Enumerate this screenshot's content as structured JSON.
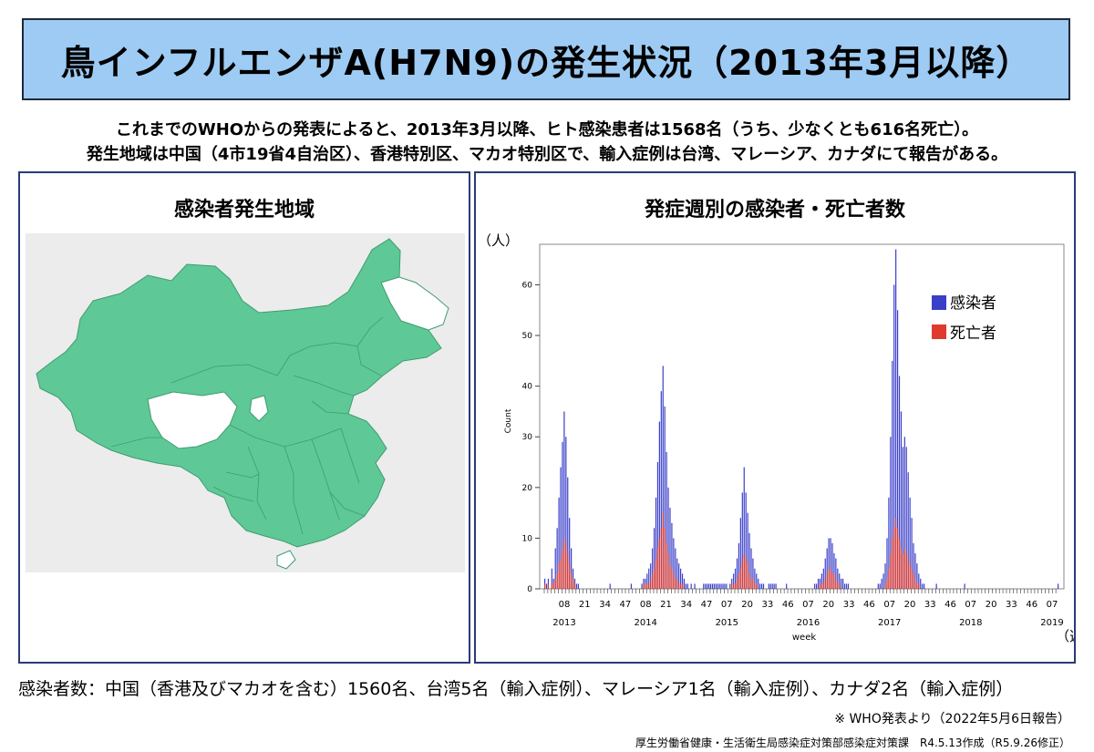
{
  "title": "鳥インフルエンザA(H7N9)の発生状況（2013年3月以降）",
  "summary": {
    "line1": "これまでのWHOからの発表によると、2013年3月以降、ヒト感染患者は1568名（うち、少なくとも616名死亡）。",
    "line2": "発生地域は中国（4市19省4自治区）、香港特別区、マカオ特別区で、輸入症例は台湾、マレーシア、カナダにて報告がある。"
  },
  "map_panel": {
    "title": "感染者発生地域",
    "colors": {
      "affected": "#5ec996",
      "unaffected": "#ffffff",
      "background": "#ececec"
    }
  },
  "chart_panel": {
    "title": "発症週別の感染者・死亡者数",
    "unit_y": "（人）",
    "unit_x": "（週）"
  },
  "chart_data": {
    "type": "bar",
    "ylabel": "Count",
    "xlabel": "week",
    "ylim": [
      0,
      68
    ],
    "yticks": [
      0,
      10,
      20,
      30,
      40,
      50,
      60
    ],
    "week_ticks": [
      "08",
      "21",
      "34",
      "47",
      "08",
      "21",
      "34",
      "47",
      "07",
      "20",
      "33",
      "46",
      "07",
      "20",
      "33",
      "46",
      "07",
      "20",
      "33",
      "46",
      "07",
      "20",
      "33",
      "46",
      "07"
    ],
    "year_labels": [
      "2013",
      "2014",
      "2015",
      "2016",
      "2017",
      "2018",
      "2019"
    ],
    "legend": [
      "感染者",
      "死亡者"
    ],
    "colors": {
      "cases": "#3a3fc9",
      "deaths": "#e03a2c"
    },
    "series": [
      {
        "name": "感染者",
        "values": [
          2,
          1,
          2,
          0,
          4,
          2,
          8,
          12,
          18,
          24,
          29,
          35,
          30,
          22,
          14,
          8,
          4,
          2,
          1,
          1,
          0,
          0,
          0,
          0,
          0,
          0,
          0,
          0,
          0,
          0,
          0,
          0,
          0,
          0,
          0,
          0,
          0,
          1,
          0,
          0,
          0,
          0,
          0,
          0,
          0,
          0,
          0,
          0,
          0,
          1,
          0,
          0,
          0,
          0,
          0,
          1,
          2,
          2,
          3,
          4,
          5,
          8,
          12,
          18,
          25,
          33,
          39,
          44,
          36,
          27,
          20,
          16,
          13,
          10,
          8,
          6,
          5,
          4,
          3,
          2,
          1,
          1,
          0,
          1,
          0,
          1,
          0,
          0,
          0,
          0,
          1,
          1,
          1,
          1,
          1,
          1,
          1,
          1,
          1,
          1,
          1,
          1,
          1,
          1,
          0,
          1,
          2,
          3,
          4,
          6,
          9,
          14,
          19,
          24,
          19,
          15,
          11,
          8,
          6,
          4,
          3,
          2,
          1,
          1,
          1,
          0,
          0,
          1,
          1,
          1,
          1,
          1,
          0,
          0,
          0,
          0,
          0,
          1,
          0,
          0,
          0,
          0,
          0,
          0,
          0,
          0,
          0,
          0,
          0,
          0,
          0,
          0,
          0,
          1,
          1,
          2,
          2,
          3,
          4,
          6,
          8,
          10,
          10,
          9,
          7,
          6,
          4,
          3,
          2,
          2,
          1,
          1,
          1,
          0,
          0,
          0,
          0,
          0,
          0,
          0,
          0,
          0,
          0,
          0,
          0,
          0,
          0,
          0,
          0,
          1,
          1,
          2,
          3,
          5,
          10,
          18,
          30,
          45,
          60,
          67,
          55,
          42,
          35,
          28,
          30,
          28,
          23,
          18,
          14,
          9,
          7,
          5,
          3,
          2,
          1,
          1,
          0,
          0,
          0,
          0,
          0,
          0,
          1,
          0,
          0,
          0,
          0,
          0,
          0,
          0,
          0,
          0,
          0,
          0,
          0,
          0,
          0,
          0,
          1,
          0,
          0,
          0,
          0,
          0,
          0,
          0,
          0,
          0,
          0,
          0,
          0,
          0,
          0,
          0,
          0,
          0,
          0,
          0,
          0,
          0,
          0,
          0,
          0,
          0,
          0,
          0,
          0,
          0,
          0,
          0,
          0,
          0,
          0,
          0,
          0,
          0,
          0,
          0,
          0,
          0,
          0,
          0,
          0,
          0,
          0,
          0,
          0,
          0,
          0,
          0,
          0,
          1
        ]
      },
      {
        "name": "死亡者",
        "values": [
          1,
          0,
          1,
          0,
          1,
          1,
          2,
          3,
          5,
          6,
          8,
          10,
          9,
          7,
          5,
          3,
          2,
          1,
          0,
          0,
          0,
          0,
          0,
          0,
          0,
          0,
          0,
          0,
          0,
          0,
          0,
          0,
          0,
          0,
          0,
          0,
          0,
          0,
          0,
          0,
          0,
          0,
          0,
          0,
          0,
          0,
          0,
          0,
          0,
          0,
          0,
          0,
          0,
          0,
          0,
          0,
          1,
          1,
          1,
          1,
          2,
          3,
          4,
          6,
          8,
          10,
          12,
          15,
          12,
          9,
          7,
          5,
          4,
          3,
          2,
          2,
          1,
          1,
          1,
          0,
          0,
          0,
          0,
          0,
          0,
          0,
          0,
          0,
          0,
          0,
          0,
          0,
          0,
          0,
          0,
          0,
          0,
          0,
          0,
          0,
          0,
          0,
          0,
          0,
          0,
          0,
          1,
          1,
          1,
          2,
          3,
          4,
          6,
          7,
          6,
          5,
          3,
          2,
          2,
          1,
          1,
          0,
          0,
          0,
          0,
          0,
          0,
          0,
          0,
          0,
          0,
          0,
          0,
          0,
          0,
          0,
          0,
          0,
          0,
          0,
          0,
          0,
          0,
          0,
          0,
          0,
          0,
          0,
          0,
          0,
          0,
          0,
          0,
          0,
          0,
          0,
          1,
          1,
          1,
          2,
          3,
          4,
          4,
          3,
          3,
          2,
          1,
          1,
          0,
          0,
          0,
          0,
          0,
          0,
          0,
          0,
          0,
          0,
          0,
          0,
          0,
          0,
          0,
          0,
          0,
          0,
          0,
          0,
          0,
          0,
          0,
          0,
          0,
          1,
          2,
          4,
          7,
          10,
          12,
          14,
          12,
          10,
          8,
          7,
          8,
          7,
          6,
          5,
          4,
          3,
          2,
          1,
          1,
          0,
          0,
          0,
          0,
          0,
          0,
          0,
          0,
          0,
          0,
          0,
          0,
          0,
          0,
          0,
          0,
          0,
          0,
          0,
          0,
          0,
          0,
          0,
          0,
          0,
          0,
          0,
          0,
          0,
          0,
          0,
          0,
          0,
          0,
          0,
          0,
          0,
          0,
          0,
          0,
          0,
          0,
          0,
          0,
          0,
          0,
          0,
          0,
          0,
          0,
          0,
          0,
          0,
          0,
          0,
          0,
          0,
          0,
          0,
          0,
          0,
          0,
          0,
          0,
          0,
          0,
          0,
          0,
          0,
          0,
          0,
          0,
          0,
          0,
          0,
          0,
          0,
          0,
          0,
          0,
          0
        ]
      }
    ]
  },
  "footer": {
    "cases_by_country": "感染者数：中国（香港及びマカオを含む）1560名、台湾5名（輸入症例）、マレーシア1名（輸入症例）、カナダ2名（輸入症例）",
    "source": "※ WHO発表より（2022年5月6日報告）",
    "credit": "厚生労働省健康・生活衛生局感染症対策部感染症対策課　R4.5.13作成（R5.9.26修正）"
  }
}
